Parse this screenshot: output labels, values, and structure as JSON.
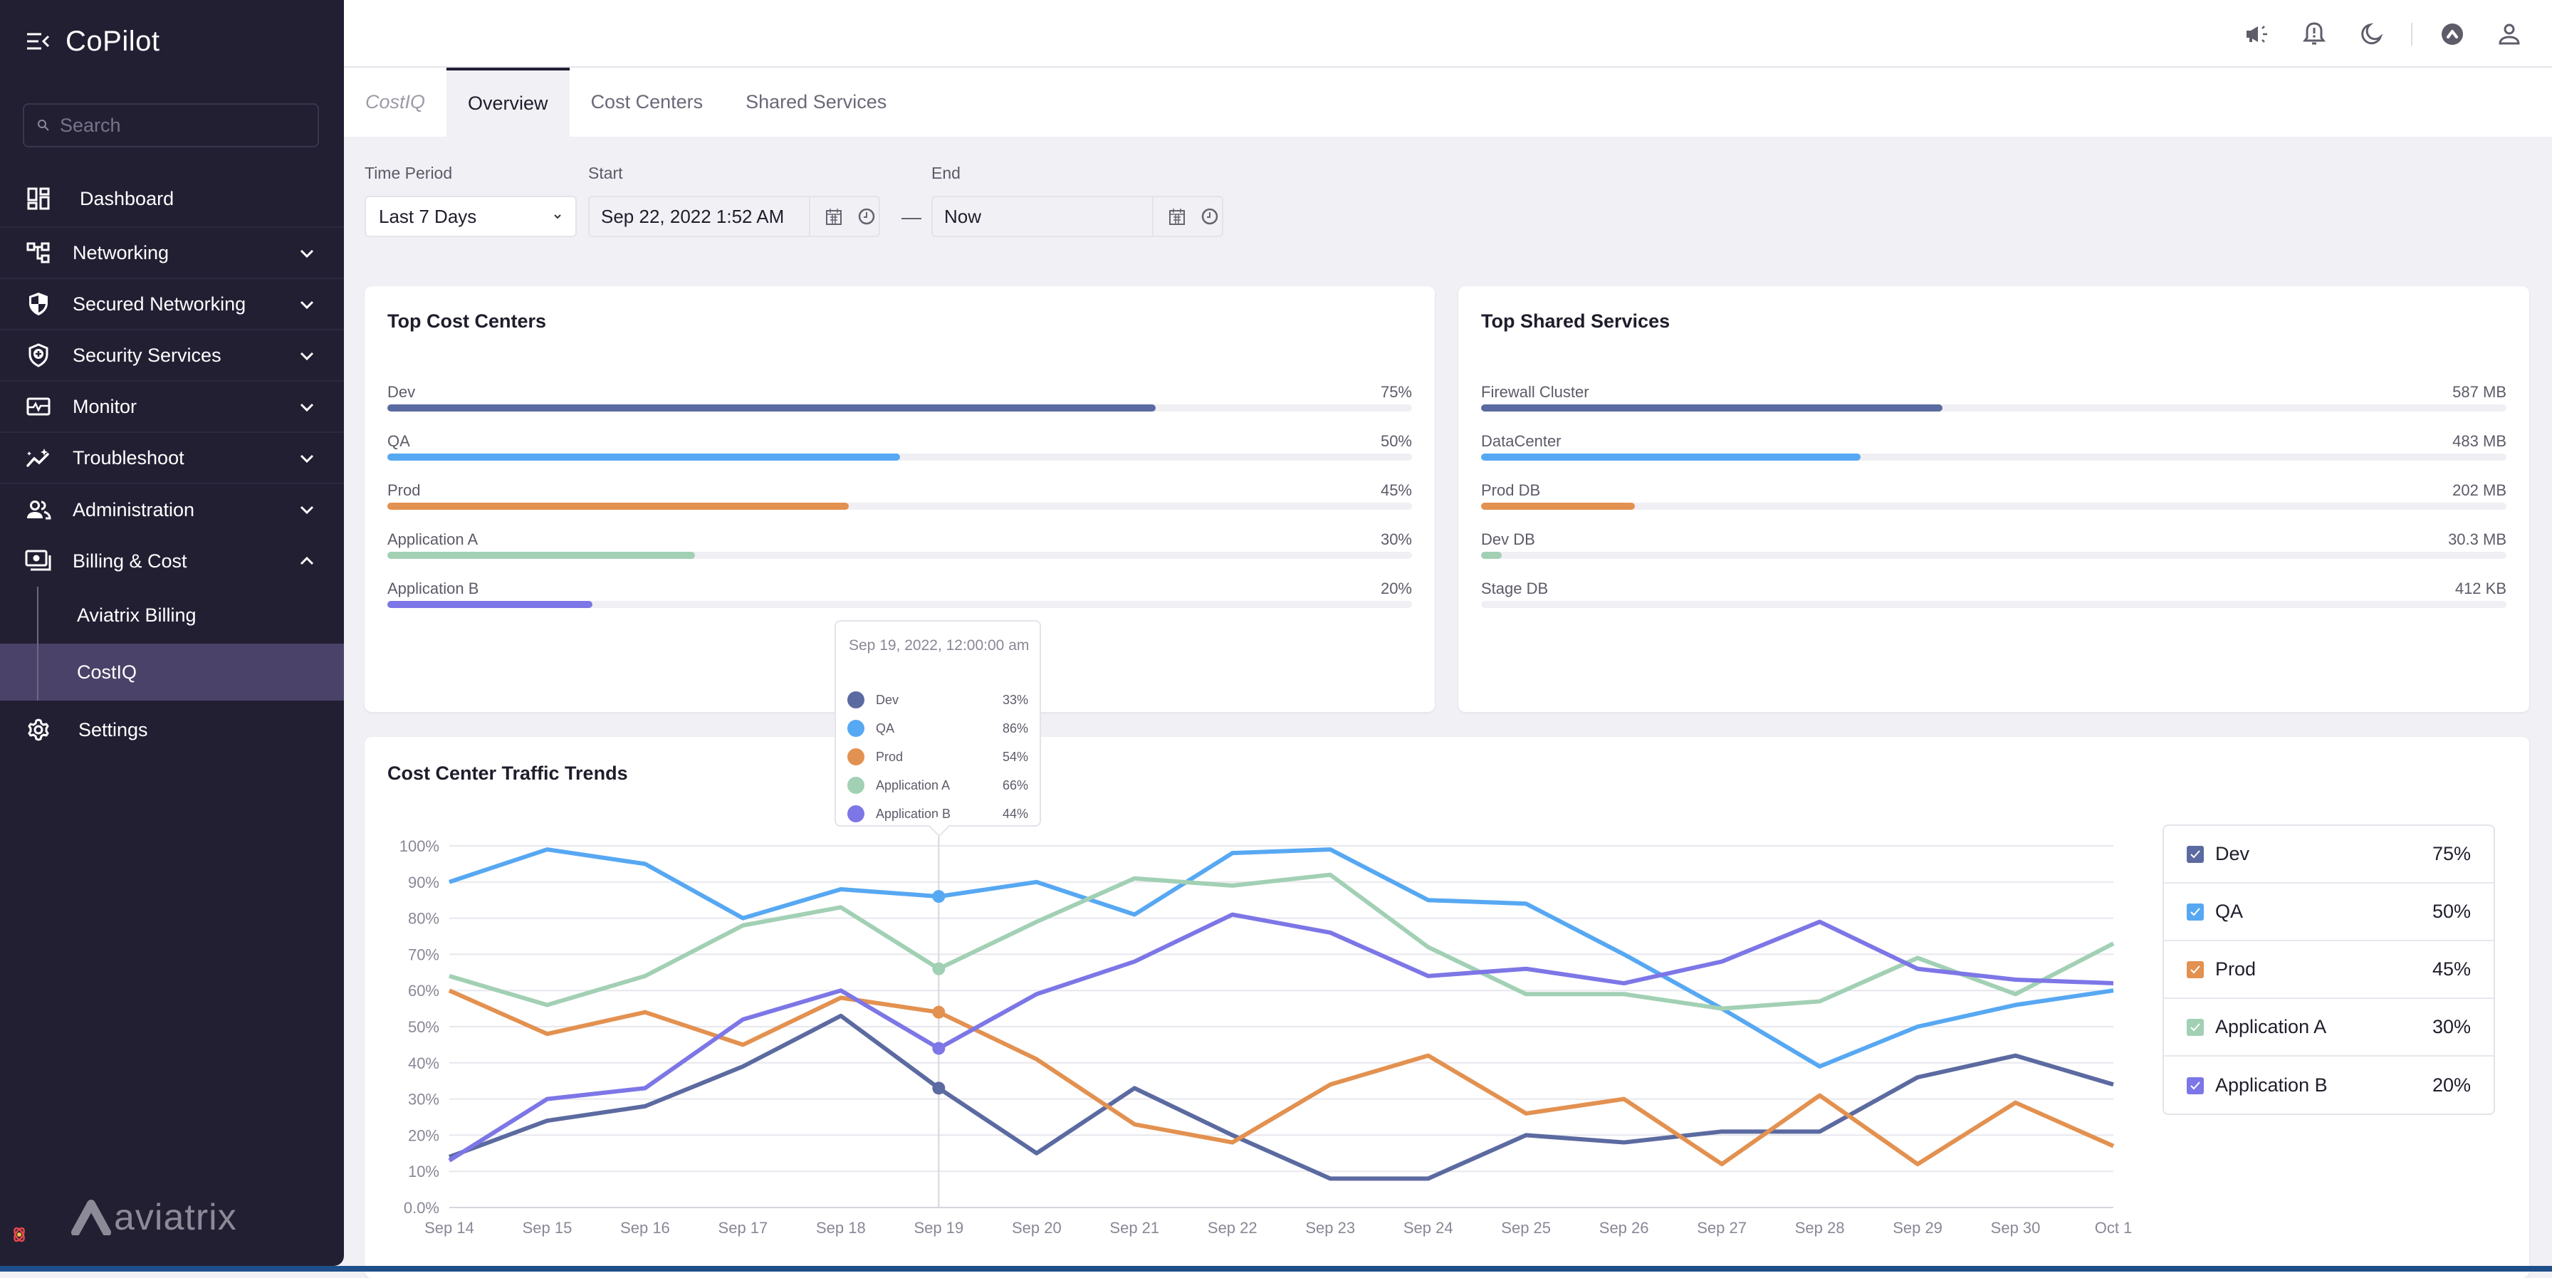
{
  "sidebar": {
    "app_title": "CoPilot",
    "search_placeholder": "Search",
    "items": [
      {
        "label": "Dashboard",
        "icon": "dashboard-icon"
      },
      {
        "label": "Networking",
        "icon": "network-icon"
      },
      {
        "label": "Secured Networking",
        "icon": "shield-half-icon"
      },
      {
        "label": "Security Services",
        "icon": "shield-plus-icon"
      },
      {
        "label": "Monitor",
        "icon": "monitor-icon"
      },
      {
        "label": "Troubleshoot",
        "icon": "troubleshoot-icon"
      },
      {
        "label": "Administration",
        "icon": "users-icon"
      },
      {
        "label": "Billing & Cost",
        "icon": "billing-icon",
        "expanded": true
      }
    ],
    "sub_items": [
      {
        "label": "Aviatrix Billing",
        "active": false
      },
      {
        "label": "CostIQ",
        "active": true
      }
    ],
    "settings_label": "Settings",
    "logo_text": "aviatrix"
  },
  "topbar": {
    "icons": [
      "megaphone-icon",
      "bell-alert-icon",
      "moon-icon",
      "aviatrix-circle-icon",
      "user-icon"
    ]
  },
  "tabs": {
    "breadcrumb": "CostIQ",
    "items": [
      {
        "label": "Overview",
        "active": true
      },
      {
        "label": "Cost Centers",
        "active": false
      },
      {
        "label": "Shared Services",
        "active": false
      }
    ]
  },
  "filters": {
    "time_period_label": "Time Period",
    "time_period_value": "Last 7 Days",
    "start_label": "Start",
    "start_value": "Sep 22, 2022 1:52 AM",
    "end_label": "End",
    "end_value": "Now",
    "separator": "—"
  },
  "top_cost_centers": {
    "title": "Top Cost Centers",
    "rows": [
      {
        "name": "Dev",
        "value": "75%",
        "fraction": 0.75,
        "color": "#5b6aa0"
      },
      {
        "name": "QA",
        "value": "50%",
        "fraction": 0.5,
        "color": "#57a8f2"
      },
      {
        "name": "Prod",
        "value": "45%",
        "fraction": 0.45,
        "color": "#e39150"
      },
      {
        "name": "Application A",
        "value": "30%",
        "fraction": 0.3,
        "color": "#a2d0b4"
      },
      {
        "name": "Application B",
        "value": "20%",
        "fraction": 0.2,
        "color": "#7d76e6"
      }
    ]
  },
  "top_shared_services": {
    "title": "Top Shared Services",
    "rows": [
      {
        "name": "Firewall Cluster",
        "value": "587 MB",
        "fraction": 0.45,
        "color": "#5b6aa0"
      },
      {
        "name": "DataCenter",
        "value": "483 MB",
        "fraction": 0.37,
        "color": "#57a8f2"
      },
      {
        "name": "Prod DB",
        "value": "202 MB",
        "fraction": 0.15,
        "color": "#e39150"
      },
      {
        "name": "Dev DB",
        "value": "30.3 MB",
        "fraction": 0.02,
        "color": "#a2d0b4"
      },
      {
        "name": "Stage DB",
        "value": "412 KB",
        "fraction": 0.0,
        "color": "#7d76e6"
      }
    ]
  },
  "traffic_trends": {
    "title": "Cost Center Traffic Trends",
    "tooltip": {
      "date": "Sep 19, 2022, 12:00:00 am",
      "rows": [
        {
          "name": "Dev",
          "value": "33%",
          "color": "#5b6aa0"
        },
        {
          "name": "QA",
          "value": "86%",
          "color": "#57a8f2"
        },
        {
          "name": "Prod",
          "value": "54%",
          "color": "#e39150"
        },
        {
          "name": "Application A",
          "value": "66%",
          "color": "#a2d0b4"
        },
        {
          "name": "Application B",
          "value": "44%",
          "color": "#7d76e6"
        }
      ]
    },
    "legend": [
      {
        "name": "Dev",
        "value": "75%",
        "checked": true,
        "color": "#5b6aa0"
      },
      {
        "name": "QA",
        "value": "50%",
        "checked": true,
        "color": "#57a8f2"
      },
      {
        "name": "Prod",
        "value": "45%",
        "checked": true,
        "color": "#e39150"
      },
      {
        "name": "Application A",
        "value": "30%",
        "checked": true,
        "color": "#a2d0b4"
      },
      {
        "name": "Application B",
        "value": "20%",
        "checked": true,
        "color": "#7d76e6"
      }
    ]
  },
  "chart_data": {
    "type": "line",
    "title": "Cost Center Traffic Trends",
    "xlabel": "",
    "ylabel": "",
    "x": [
      "Sep 14",
      "Sep 15",
      "Sep 16",
      "Sep 17",
      "Sep 18",
      "Sep 19",
      "Sep 20",
      "Sep 21",
      "Sep 22",
      "Sep 23",
      "Sep 24",
      "Sep 25",
      "Sep 26",
      "Sep 27",
      "Sep 28",
      "Sep 29",
      "Sep 30",
      "Oct 1"
    ],
    "yticks": [
      "0.0%",
      "10%",
      "20%",
      "30%",
      "40%",
      "50%",
      "60%",
      "70%",
      "80%",
      "90%",
      "100%"
    ],
    "ylim": [
      0,
      100
    ],
    "grid": true,
    "legend_position": "right",
    "hover_index": 5,
    "series": [
      {
        "name": "Dev",
        "color": "#5b6aa0",
        "values": [
          14,
          24,
          28,
          39,
          53,
          33,
          15,
          33,
          20,
          8,
          8,
          20,
          18,
          21,
          21,
          36,
          42,
          34
        ]
      },
      {
        "name": "QA",
        "color": "#57a8f2",
        "values": [
          90,
          99,
          95,
          80,
          88,
          86,
          90,
          81,
          98,
          99,
          85,
          84,
          70,
          55,
          39,
          50,
          56,
          60
        ]
      },
      {
        "name": "Prod",
        "color": "#e39150",
        "values": [
          60,
          48,
          54,
          45,
          58,
          54,
          41,
          23,
          18,
          34,
          42,
          26,
          30,
          12,
          31,
          12,
          29,
          17
        ]
      },
      {
        "name": "Application A",
        "color": "#a2d0b4",
        "values": [
          64,
          56,
          64,
          78,
          83,
          66,
          79,
          91,
          89,
          92,
          72,
          59,
          59,
          55,
          57,
          69,
          59,
          73
        ]
      },
      {
        "name": "Application B",
        "color": "#7d76e6",
        "values": [
          13,
          30,
          33,
          52,
          60,
          44,
          59,
          68,
          81,
          76,
          64,
          66,
          62,
          68,
          79,
          66,
          63,
          62
        ]
      }
    ]
  }
}
